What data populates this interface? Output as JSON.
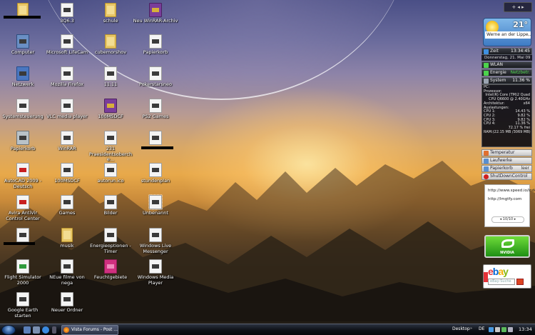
{
  "colors": {
    "taskbar": "#0e1117",
    "gadget_green": "#4cd34c",
    "nvidia_green": "#2fa81f",
    "ebay_red": "#e53238",
    "ebay_blue": "#0064d2",
    "ebay_yellow": "#f5af02",
    "ebay_green": "#86b817"
  },
  "desktop_icons": [
    {
      "label": "",
      "icon": "folder-icon"
    },
    {
      "label": "3Q6.3",
      "icon": "file-icon"
    },
    {
      "label": "schule",
      "icon": "folder-icon"
    },
    {
      "label": "Neu WinRAR-Archiv",
      "icon": "winrar-icon"
    },
    {
      "label": "Computer",
      "icon": "computer-icon"
    },
    {
      "label": "Microsoft LifeCam",
      "icon": "file-icon"
    },
    {
      "label": "cubemorshov",
      "icon": "folder-icon"
    },
    {
      "label": "Papierkorb",
      "icon": "file-icon"
    },
    {
      "label": "Netzwerk",
      "icon": "network-icon"
    },
    {
      "label": "Mozilla Firefox",
      "icon": "file-icon"
    },
    {
      "label": "11.11",
      "icon": "file-icon"
    },
    {
      "label": "Pokerstarsneo",
      "icon": "file-icon"
    },
    {
      "label": "Systemsteuerung",
      "icon": "file-icon"
    },
    {
      "label": "VLC media player",
      "icon": "file-icon"
    },
    {
      "label": "100MSDCF",
      "icon": "winrar-icon"
    },
    {
      "label": "PS2 Games",
      "icon": "file-icon"
    },
    {
      "label": "Papierkorb",
      "icon": "trash-icon"
    },
    {
      "label": "WinRAR",
      "icon": "file-icon"
    },
    {
      "label": "231 Praesidentsoberche...",
      "icon": "file-icon"
    },
    {
      "label": "",
      "icon": "file-icon"
    },
    {
      "label": "AutoCAD 2009 - Deutsch",
      "icon": "acrobat-icon"
    },
    {
      "label": "100MSDCF",
      "icon": "file-icon"
    },
    {
      "label": "autorun.ico",
      "icon": "file-icon"
    },
    {
      "label": "stundenplan",
      "icon": "file-icon"
    },
    {
      "label": "Avira AntiVir Control Center",
      "icon": "acrobat-icon"
    },
    {
      "label": "Games",
      "icon": "file-icon"
    },
    {
      "label": "Bilder",
      "icon": "file-icon"
    },
    {
      "label": "Unbenannt",
      "icon": "file-icon"
    },
    {
      "label": "",
      "icon": "file-icon"
    },
    {
      "label": "musik",
      "icon": "folder-icon"
    },
    {
      "label": "Energieoptionen - Timer",
      "icon": "file-icon"
    },
    {
      "label": "Windows Live Messenger",
      "icon": "file-icon"
    },
    {
      "label": "Flight Simulator 2000",
      "icon": "green-icon"
    },
    {
      "label": "NEue filme von nega",
      "icon": "file-icon"
    },
    {
      "label": "Feuchtgebiete",
      "icon": "pink-icon"
    },
    {
      "label": "Windows Media Player",
      "icon": "file-icon"
    },
    {
      "label": "Google Earth starten",
      "icon": "file-icon"
    },
    {
      "label": "Neuer Ordner",
      "icon": "file-icon"
    }
  ],
  "sidebar": {
    "weather": {
      "temp": "21°",
      "city": "Werne an der Lippe,..."
    },
    "zeit": {
      "label": "Zeit",
      "value": "13:34:45",
      "date": "Donnerstag, 21. Mai 09"
    },
    "wlan": {
      "label": "WLAN"
    },
    "energie": {
      "label": "Energie",
      "value": "Netzbetr."
    },
    "system": {
      "label": "System",
      "value": "11.36 %",
      "pc": "PC:",
      "prozessor_label": "Prozessor:",
      "prozessor_value": "Intel(R) Core (TM)2 Quad CPU Q6600 @ 2.40GHz",
      "architektur_label": "Architektur:",
      "architektur_value": "x64",
      "auslastungen_label": "Auslastungen:",
      "cpu1_label": "CPU 1:",
      "cpu1": "14.43 %",
      "cpu2_label": "CPU 2:",
      "cpu2": "9.82 %",
      "cpu3_label": "CPU 3:",
      "cpu3": "9.82 %",
      "cpu4_label": "CPU 4:",
      "cpu4": "11.36 %",
      "free": "72.17 % frei",
      "ram_label": "RAM:",
      "ram": "(22.15 MB /3069 MB)"
    },
    "temperatur": {
      "label": "Temperatur"
    },
    "laufwerke": {
      "label": "Laufwerke"
    },
    "papierkorb": {
      "label": "Papierkorb",
      "value": "leer"
    },
    "shutdown": {
      "label": "ShutDownControl"
    },
    "notes": {
      "line1": "http://www.speed.io/index_de.html",
      "line2": "http://lmgtfy.com",
      "pager": "10/10"
    },
    "nvidia": {
      "brand": "NVIDIA"
    },
    "ebay": {
      "search_placeholder": "eBay-Suche"
    }
  },
  "taskbar": {
    "task_label": "Vista Forums - Post ...",
    "desktop": "Desktop",
    "lang": "DE",
    "clock": "13:34"
  }
}
